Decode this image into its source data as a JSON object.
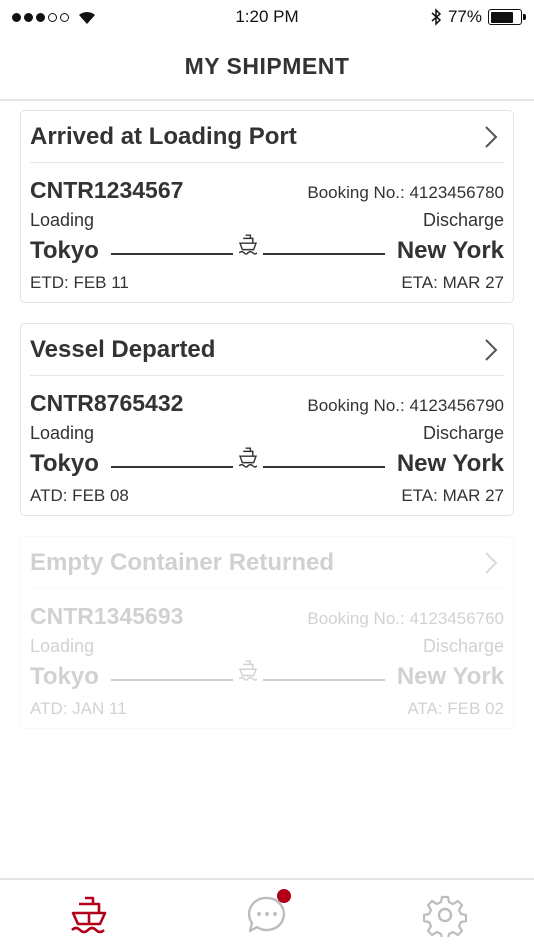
{
  "status_bar": {
    "time": "1:20 PM",
    "battery": "77%",
    "battery_level": 0.77
  },
  "header": {
    "title": "MY SHIPMENT"
  },
  "labels": {
    "booking_prefix": "Booking No.: ",
    "loading": "Loading",
    "discharge": "Discharge"
  },
  "shipments": [
    {
      "status": "Arrived at Loading Port",
      "container": "CNTR1234567",
      "booking": "Booking No.: 4123456780",
      "loading_label": "Loading",
      "discharge_label": "Discharge",
      "origin": "Tokyo",
      "destination": "New York",
      "departure": "ETD: FEB 11",
      "arrival": "ETA: MAR 27"
    },
    {
      "status": "Vessel Departed",
      "container": "CNTR8765432",
      "booking": "Booking No.: 4123456790",
      "loading_label": "Loading",
      "discharge_label": "Discharge",
      "origin": "Tokyo",
      "destination": "New York",
      "departure": "ATD: FEB 08",
      "arrival": "ETA: MAR 27"
    },
    {
      "status": "Empty Container Returned",
      "container": "CNTR1345693",
      "booking": "Booking No.: 4123456760",
      "loading_label": "Loading",
      "discharge_label": "Discharge",
      "origin": "Tokyo",
      "destination": "New York",
      "departure": "ATD: JAN 11",
      "arrival": "ATA: FEB 02"
    }
  ],
  "tabs": [
    {
      "icon": "ship-icon",
      "active": true
    },
    {
      "icon": "chat-icon",
      "badge": true
    },
    {
      "icon": "gear-icon"
    }
  ],
  "colors": {
    "accent": "#b2001a",
    "text": "#333333",
    "inactive_icon": "#bdbdbd",
    "border": "#e3e3e3"
  }
}
